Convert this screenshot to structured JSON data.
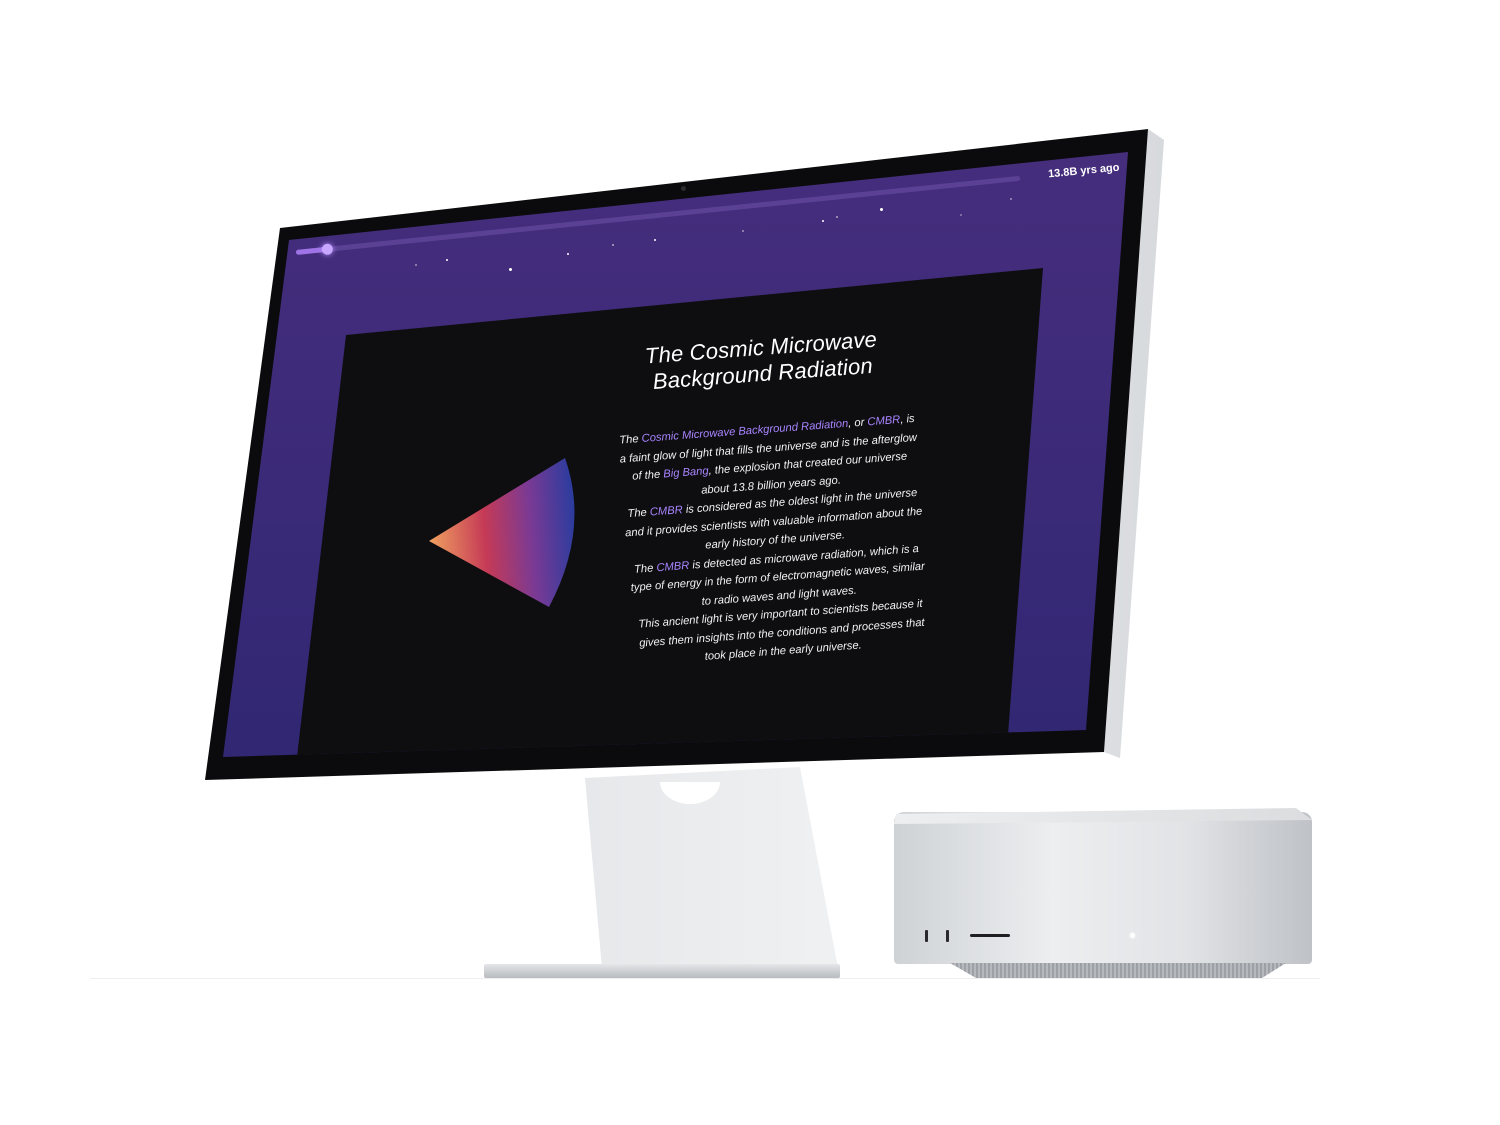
{
  "header": {
    "time_label": "13.8B yrs ago",
    "timeline_progress": 0.04
  },
  "article": {
    "title_line1": "The Cosmic Microwave",
    "title_line2": "Background Radiation",
    "p1": {
      "a": "The ",
      "b": "Cosmic Microwave Background Radiation",
      "c": ", or ",
      "d": "CMBR",
      "e": ", is a faint glow of light that fills the universe and is the afterglow of the ",
      "f": "Big Bang",
      "g": ", the explosion that created our universe about 13.8 billion years ago."
    },
    "p2": {
      "a": "The ",
      "b": "CMBR",
      "c": " is considered as the oldest light in the universe and it provides scientists with valuable information about the early history of the universe."
    },
    "p3": {
      "a": "The ",
      "b": "CMBR",
      "c": " is detected as microwave radiation, which is a type of energy in the form of electromagnetic waves, similar to radio waves and light waves."
    },
    "p4": "This ancient light is very important to scientists because it gives them insights into the conditions and processes that took place in the early universe."
  },
  "colors": {
    "screen_top": "#4a2f7e",
    "screen_bottom": "#24226a",
    "panel": "#0e0e10",
    "accent": "#a884ff",
    "fan_start": "#f0a060",
    "fan_mid": "#c53a56",
    "fan_end": "#2c3c9e"
  },
  "icons": {
    "timeline_knob": "circle-dot"
  }
}
